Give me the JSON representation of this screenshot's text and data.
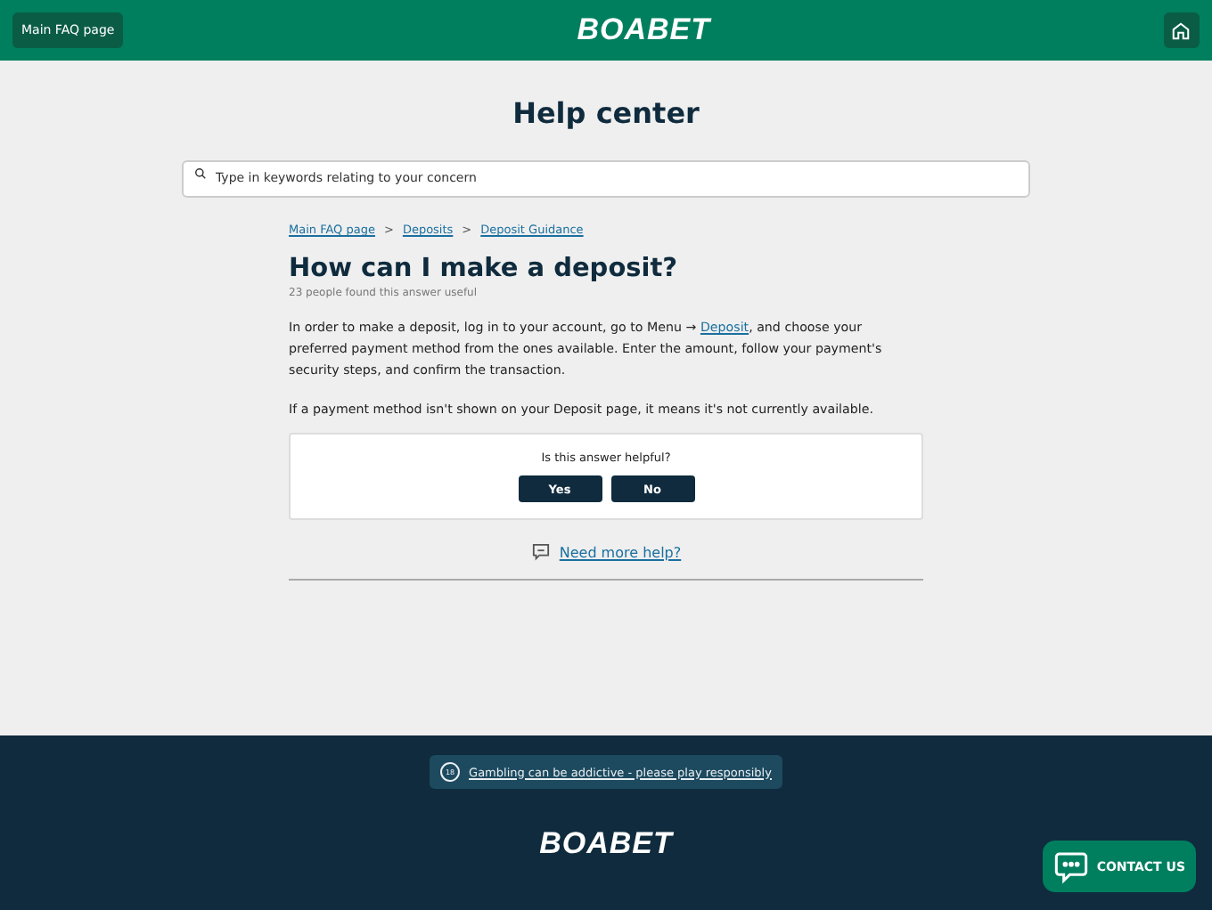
{
  "header": {
    "faq_button": "Main FAQ page",
    "logo": "BOABET"
  },
  "title": "Help center",
  "search": {
    "placeholder": "Type in keywords relating to your concern"
  },
  "breadcrumbs": [
    "Main FAQ page",
    "Deposits",
    "Deposit Guidance"
  ],
  "breadcrumb_separator": ">",
  "article": {
    "title": "How can I make a deposit?",
    "useful_count": "23 people found this answer useful",
    "paragraphs": [
      [
        {
          "kind": "text",
          "text": "In order to make a deposit, log in to your account, go to Menu → "
        },
        {
          "kind": "link",
          "text": "Deposit"
        },
        {
          "kind": "text",
          "text": ", and choose your preferred payment method from the ones available. Enter the amount, follow your payment's security steps, and confirm the transaction."
        }
      ],
      [
        {
          "kind": "text",
          "text": "If a payment method isn't shown on your Deposit page, it means it's not currently available."
        }
      ]
    ]
  },
  "feedback": {
    "question": "Is this answer helpful?",
    "buttons": [
      "Yes",
      "No"
    ]
  },
  "more_help": "Need more help?",
  "footer": {
    "age_badge": "18",
    "notice": "Gambling can be addictive - please play responsibly",
    "logo": "BOABET"
  },
  "contact_button": "CONTACT US"
}
